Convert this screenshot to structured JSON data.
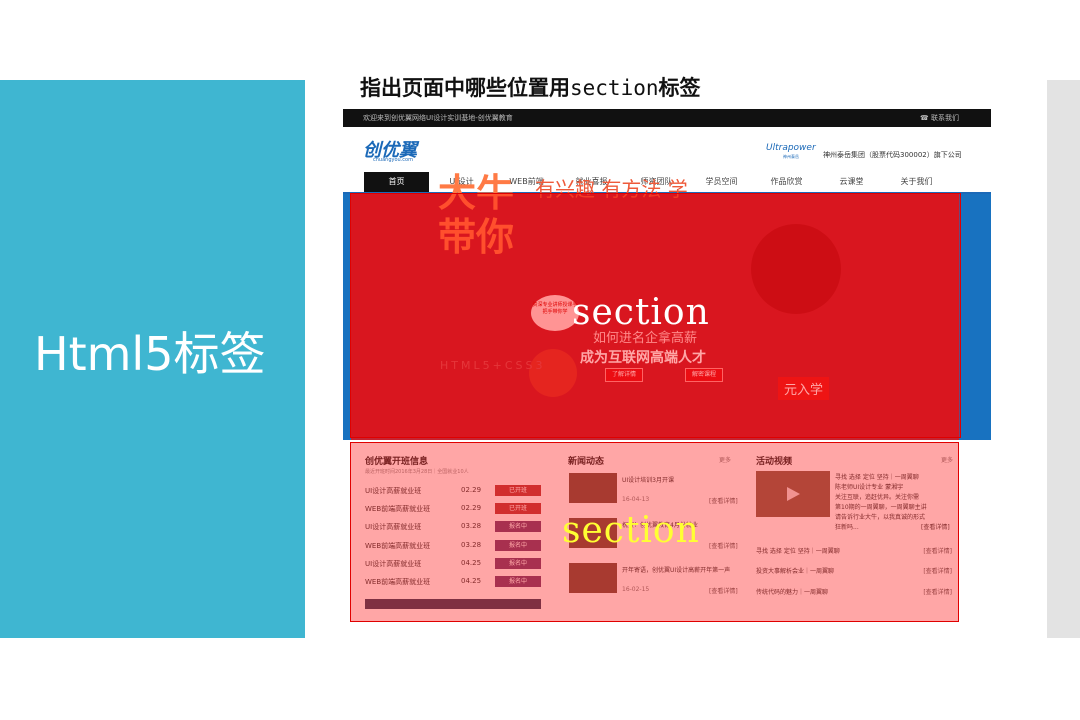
{
  "slide": {
    "side_title": "Html5标签",
    "question_prefix": "指出页面中哪些位置用",
    "question_code": "section",
    "question_suffix": "标签"
  },
  "site": {
    "topbar": {
      "welcome": "欢迎来到创优翼网络UI设计实训基地-创优翼教育",
      "contact": "联系我们"
    },
    "logo": "创优翼",
    "logo_sub": "chuangyou.com",
    "brand": "Ultrapower",
    "brand_sub": "神州泰岳",
    "company": "神州泰岳集团（股票代码300002）旗下公司",
    "nav": [
      "首页",
      "UI设计",
      "WEB前端",
      "就业喜报",
      "师资团队",
      "学员空间",
      "作品欣赏",
      "云课堂",
      "关于我们"
    ],
    "banner": {
      "big_text": "大牛带你",
      "top_text": "有兴趣 有方法 学",
      "mid_text": "如何进名企拿高薪",
      "sub_text": "成为互联网高端人才",
      "h5_text": "HTML5+CSS3",
      "bubble_text": "资深专业讲师授课手把手带你学",
      "btn_detail": "了解详情",
      "btn_apply": "解密课程",
      "enroll_text": "元入学"
    },
    "classes": {
      "title": "创优翼开班信息",
      "subtitle": "最近开班时间2016年3月28日｜全国就业10人",
      "rows": [
        {
          "name": "UI设计高薪就业班",
          "date": "02.29",
          "status": "已开班",
          "color": "#b84848"
        },
        {
          "name": "WEB前端高薪就业班",
          "date": "02.29",
          "status": "已开班",
          "color": "#b84848"
        },
        {
          "name": "UI设计高薪就业班",
          "date": "03.28",
          "status": "报名中",
          "color": "#7a4b7a"
        },
        {
          "name": "WEB前端高薪就业班",
          "date": "03.28",
          "status": "报名中",
          "color": "#7a4b7a"
        },
        {
          "name": "UI设计高薪就业班",
          "date": "04.25",
          "status": "报名中",
          "color": "#7a4b7a"
        },
        {
          "name": "WEB前端高薪就业班",
          "date": "04.25",
          "status": "报名中",
          "color": "#7a4b7a"
        }
      ]
    },
    "news": {
      "title": "新闻动态",
      "more": "更多",
      "items": [
        {
          "title": "UI设计培训3月开课",
          "date": "16-04-13",
          "link": "[查看详情]"
        },
        {
          "title": "祝贺！创优翼教育4月份就业",
          "date": "",
          "link": "[查看详情]"
        },
        {
          "title": "开年寄语，创优翼UI设计高薪开年第一声",
          "date": "16-02-15",
          "link": "[查看详情]"
        }
      ]
    },
    "video": {
      "title": "活动视频",
      "more": "更多",
      "feature_lines": [
        "寻找 选择 定位 坚持｜一周翼聊",
        "陈老师UI设计专业 蒙湘宇",
        "关注互联，追赶优异。关注你需",
        "第10期的一周翼聊，一周翼聊主讲",
        "请告诉行业大牛，以我真诚的形式",
        "狂新吗..."
      ],
      "feature_link": "[查看详情]",
      "rows": [
        {
          "title": "寻找 选择 定位 坚持｜一周翼聊",
          "link": "[查看详情]"
        },
        {
          "title": "投资大事解析会业｜一周翼聊",
          "link": "[查看详情]"
        },
        {
          "title": "传统代码的魅力｜一周翼聊",
          "link": "[查看详情]"
        }
      ]
    }
  },
  "annotations": [
    {
      "label": "section",
      "color": "#ffffff"
    },
    {
      "label": "section",
      "color": "#ffff33"
    }
  ],
  "colors": {
    "accent": "#3fb6d1",
    "overlay": "#e00000",
    "brand_blue": "#1b69b8"
  }
}
